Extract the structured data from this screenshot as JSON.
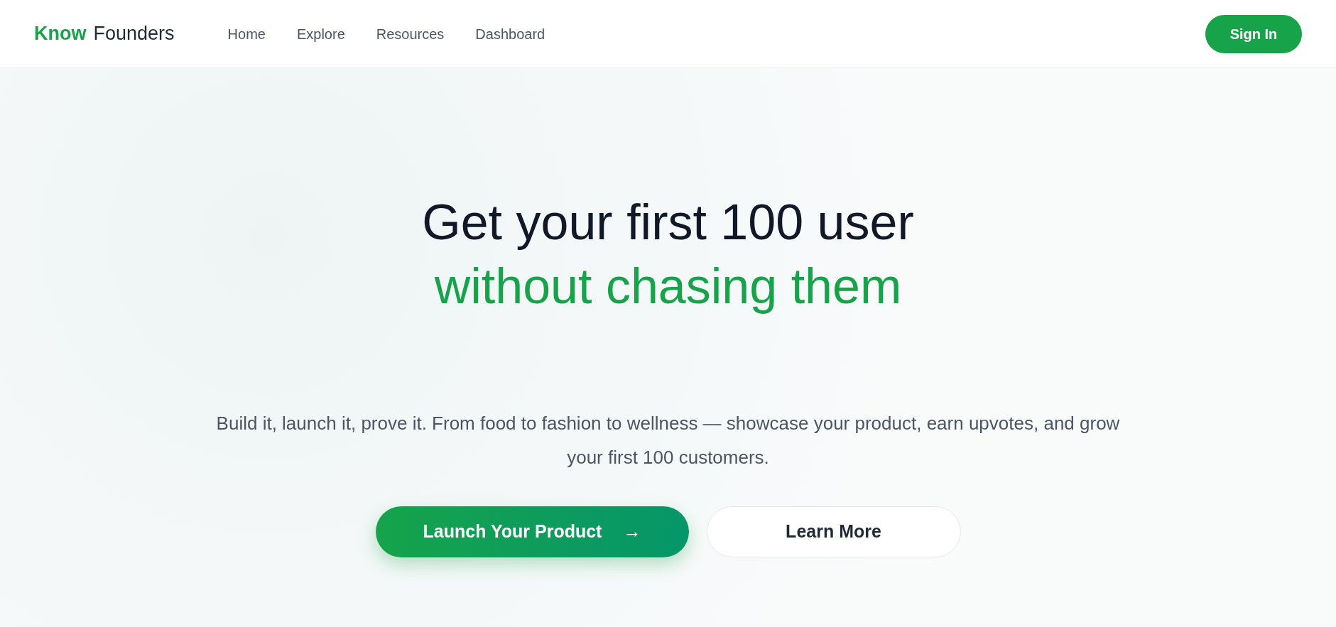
{
  "header": {
    "logo": {
      "first": "Know",
      "second": "Founders"
    },
    "nav": [
      {
        "label": "Home"
      },
      {
        "label": "Explore"
      },
      {
        "label": "Resources"
      },
      {
        "label": "Dashboard"
      }
    ],
    "sign_in": "Sign In"
  },
  "hero": {
    "title_line_1": "Get your first 100 user",
    "title_line_2": "without chasing them",
    "description": "Build it, launch it, prove it. From food to fashion to wellness — showcase your product, earn upvotes, and grow your first 100 customers.",
    "buttons": [
      {
        "kind": "primary",
        "label": "Launch Your Product",
        "arrow": "→"
      },
      {
        "kind": "secondary",
        "label": "Learn More"
      }
    ]
  }
}
